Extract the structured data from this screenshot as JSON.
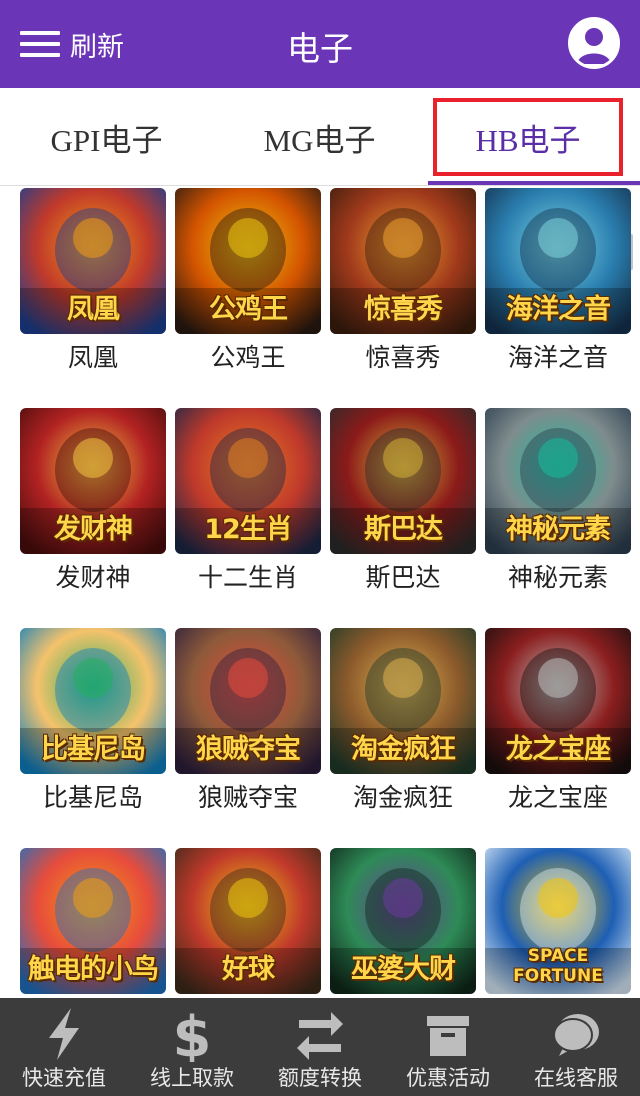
{
  "header": {
    "menu_label": "刷新",
    "title": "电子",
    "accent_color": "#6a35b6"
  },
  "tabs": [
    {
      "label": "GPI电子",
      "active": false
    },
    {
      "label": "MG电子",
      "active": false
    },
    {
      "label": "HB电子",
      "active": true
    }
  ],
  "games": [
    {
      "name": "凤凰",
      "thumb_text": "凤凰",
      "icon": "phoenix-art"
    },
    {
      "name": "公鸡王",
      "thumb_text": "公鸡王",
      "icon": "rooster-art"
    },
    {
      "name": "惊喜秀",
      "thumb_text": "惊喜秀",
      "icon": "wrestler-art"
    },
    {
      "name": "海洋之音",
      "thumb_text": "海洋之音",
      "icon": "mermaid-art"
    },
    {
      "name": "发财神",
      "thumb_text": "发财神",
      "icon": "fortune-god-art"
    },
    {
      "name": "十二生肖",
      "thumb_text": "12生肖",
      "icon": "lantern-art"
    },
    {
      "name": "斯巴达",
      "thumb_text": "斯巴达",
      "icon": "spartan-helmet-art"
    },
    {
      "name": "神秘元素",
      "thumb_text": "神秘元素",
      "icon": "elements-art"
    },
    {
      "name": "比基尼岛",
      "thumb_text": "比基尼岛",
      "icon": "beach-art"
    },
    {
      "name": "狼贼夺宝",
      "thumb_text": "狼贼夺宝",
      "icon": "wolf-art"
    },
    {
      "name": "淘金疯狂",
      "thumb_text": "淘金疯狂",
      "icon": "prospector-art"
    },
    {
      "name": "龙之宝座",
      "thumb_text": "龙之宝座",
      "icon": "dragon-art"
    },
    {
      "name": "",
      "thumb_text": "触电的小鸟",
      "icon": "birds-art"
    },
    {
      "name": "",
      "thumb_text": "好球",
      "icon": "bowling-art"
    },
    {
      "name": "",
      "thumb_text": "巫婆大财",
      "icon": "witch-art"
    },
    {
      "name": "",
      "thumb_text": "SPACE FORTUNE",
      "icon": "astronaut-art"
    }
  ],
  "bottom_nav": [
    {
      "label": "快速充值",
      "icon": "lightning-icon"
    },
    {
      "label": "线上取款",
      "icon": "dollar-icon"
    },
    {
      "label": "额度转换",
      "icon": "transfer-arrows-icon"
    },
    {
      "label": "优惠活动",
      "icon": "archive-box-icon"
    },
    {
      "label": "在线客服",
      "icon": "chat-bubble-icon"
    }
  ]
}
